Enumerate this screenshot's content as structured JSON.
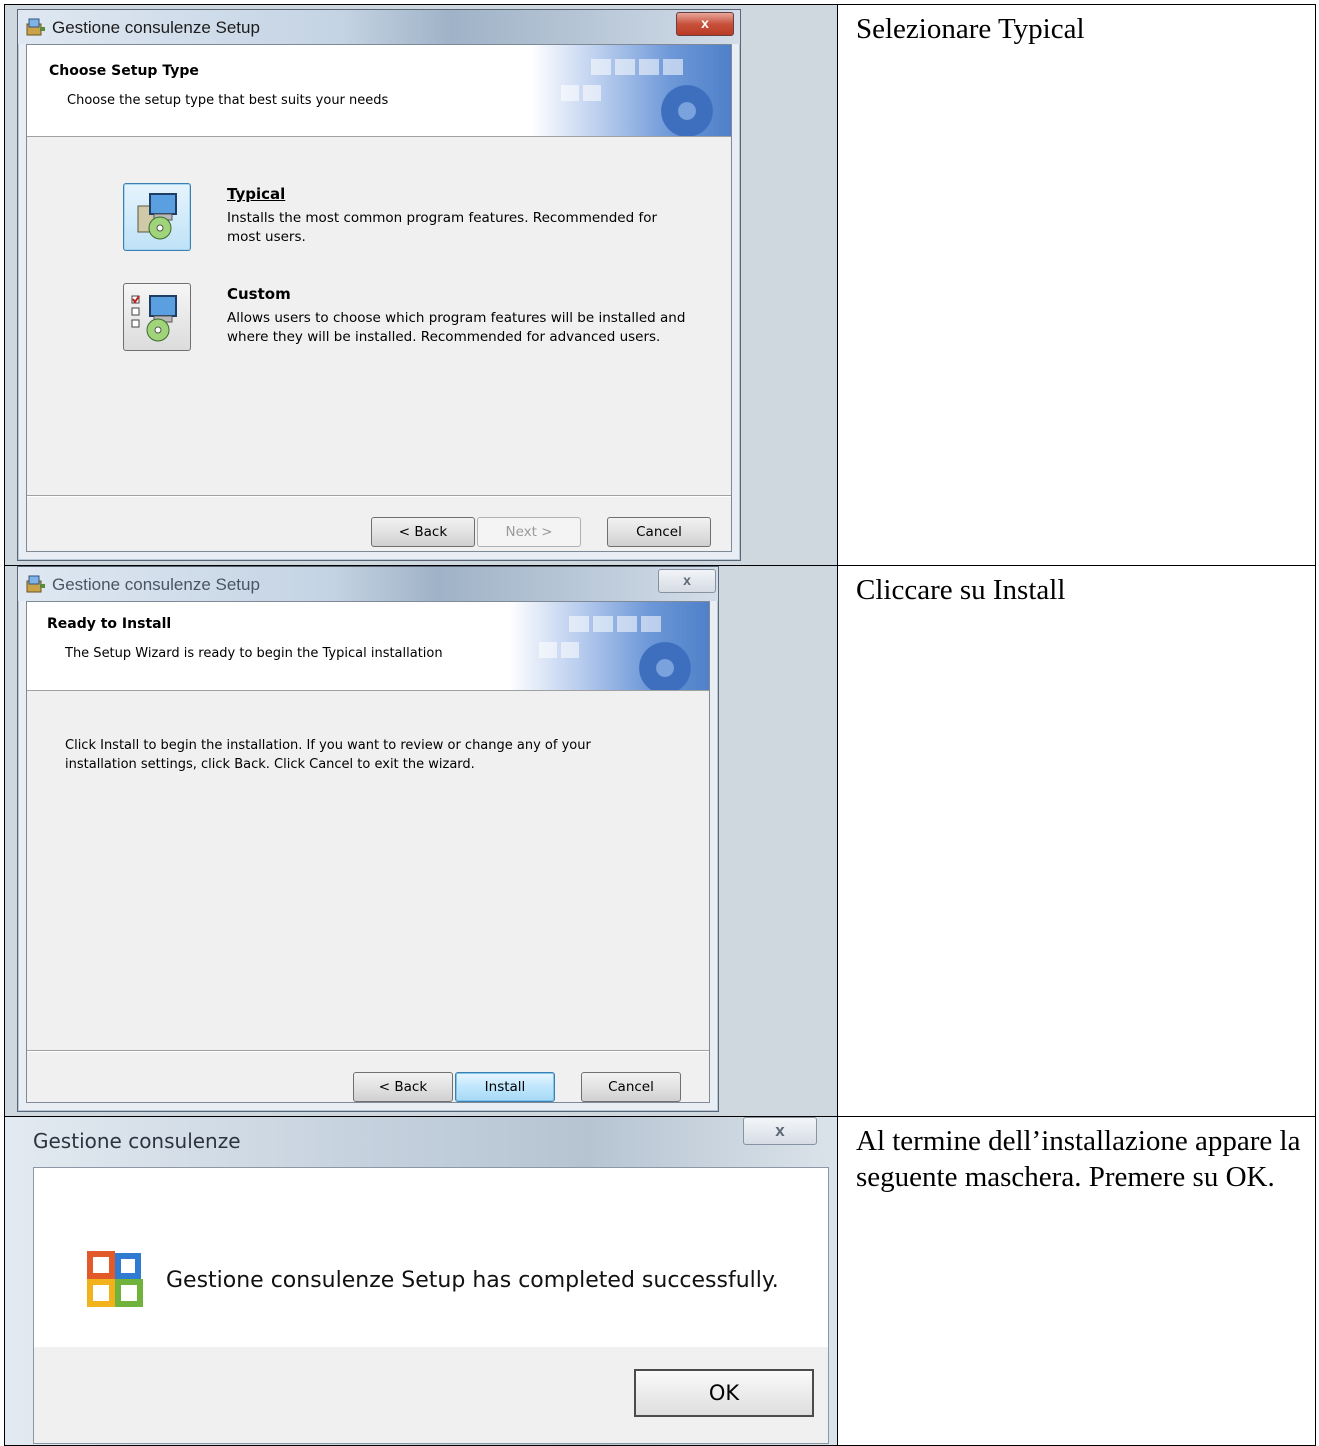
{
  "step1": {
    "window_title": "Gestione consulenze Setup",
    "close_label": "x",
    "heading": "Choose Setup Type",
    "subheading": "Choose the setup type that best suits your needs",
    "options": [
      {
        "title": "Typical",
        "description": "Installs the most common program features. Recommended for most users.",
        "icon": "typical-setup-icon",
        "selected": true
      },
      {
        "title": "Custom",
        "description": "Allows users to choose which program features will be installed and where they will be installed. Recommended for advanced users.",
        "icon": "custom-setup-icon",
        "selected": false
      }
    ],
    "buttons": {
      "back": "< Back",
      "next": "Next >",
      "cancel": "Cancel"
    },
    "note": "Selezionare Typical"
  },
  "step2": {
    "window_title": "Gestione consulenze Setup",
    "close_label": "x",
    "heading": "Ready to Install",
    "subheading": "The Setup Wizard is ready to begin the Typical installation",
    "body_line1": "Click Install to begin the installation.  If you want to review or change any of your",
    "body_line2": "installation settings, click Back.  Click Cancel to exit the wizard.",
    "buttons": {
      "back": "< Back",
      "install": "Install",
      "cancel": "Cancel"
    },
    "note": "Cliccare su Install"
  },
  "step3": {
    "window_title": "Gestione consulenze",
    "close_label": "x",
    "message": "Gestione consulenze Setup has completed successfully.",
    "icon": "office-logo-icon",
    "ok_label": "OK",
    "note": "Al termine dell’installazione appare la seguente maschera. Premere su OK."
  },
  "colors": {
    "selected_button": "#bfe2f7",
    "banner_blue": "#4f80c9",
    "close_red": "#c8513c"
  }
}
